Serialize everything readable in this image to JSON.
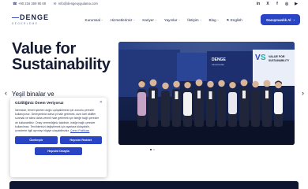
{
  "topbar": {
    "phone": "+90 216 369 90 69",
    "email": "info@dengeuygulama.com",
    "social": [
      "in",
      "X",
      "f",
      "◎",
      "▶"
    ]
  },
  "logo": {
    "word": "DENGE",
    "sub": "DEGERLEME"
  },
  "nav": [
    {
      "label": "Kurumsal",
      "chevron": true
    },
    {
      "label": "Hizmetlerimiz",
      "chevron": true
    },
    {
      "label": "Kariyer",
      "chevron": true
    },
    {
      "label": "Yayınlar",
      "chevron": true
    },
    {
      "label": "İletişim",
      "chevron": true
    },
    {
      "label": "Blog",
      "chevron": true
    },
    {
      "label": "English",
      "chevron": false
    }
  ],
  "cta": {
    "label": "Danışmanlık Al"
  },
  "hero": {
    "title_line1": "Value for",
    "title_line2": "Sustainability",
    "subtitle": "Yeşil binalar ve"
  },
  "photo": {
    "banner_brand": "DENGE",
    "banner_sub": "DEGERLEME",
    "banner_text_1": "VALUE FOR",
    "banner_text_2": "SUSTAINABILITY"
  },
  "cookie": {
    "title": "Gizliliğiniz Önem Veriyoruz",
    "body": "İdemizde, temel işlevleri doğru çalışabilmesi için zorunlu çerezler kullanıyoruz. Deneyiminizi daha iyi hale getirmek, size özel aktifler sunmak ve sitesi daha verimli hale getirmek için isteğe bağlı çerezler de kullanabiliriz. Onay vermediğiniz takdirde, isteğe bağlı çerezler kullanılmaz. Tercihlerinizi değiştirmek için ayarlara tıklayabilir, çerezlerle ilgili ayrıntıyı bilgiye ulaşabilirsiniz.",
    "link": "Çerez Politikası",
    "btn_accept": "Özelleştir",
    "btn_reject": "Hepsini Reddet",
    "btn_all": "Hepsini Onayla"
  },
  "colors": {
    "accent": "#2945c6",
    "dark": "#141b33"
  }
}
